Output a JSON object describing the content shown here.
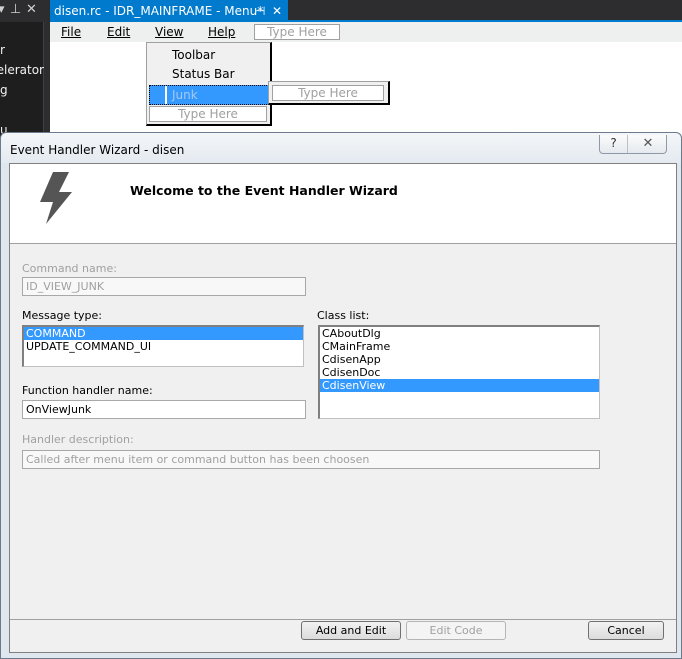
{
  "ide": {
    "side_panel_items": [
      "r",
      "elerator",
      "g",
      "",
      "u"
    ],
    "document_tab": {
      "title": "disen.rc - IDR_MAINFRAME - Menu*",
      "pin_icon": "pin-icon",
      "close_icon": "close-icon"
    },
    "menu_editor": {
      "menubar_items": [
        "File",
        "Edit",
        "View",
        "Help"
      ],
      "menubar_type_here": "Type Here",
      "view_dropdown_items": [
        "Toolbar",
        "Status Bar"
      ],
      "selected_item": "Junk",
      "dropdown_type_here": "Type Here",
      "submenu_type_here": "Type Here"
    }
  },
  "dialog": {
    "title": "Event Handler Wizard - disen",
    "help_button": "?",
    "close_button": "✕",
    "banner_title": "Welcome to the Event Handler Wizard",
    "command_name": {
      "label": "Command name:",
      "value": "ID_VIEW_JUNK"
    },
    "message_type": {
      "label": "Message type:",
      "items": [
        "COMMAND",
        "UPDATE_COMMAND_UI"
      ],
      "selected_index": 0
    },
    "class_list": {
      "label": "Class list:",
      "items": [
        "CAboutDlg",
        "CMainFrame",
        "CdisenApp",
        "CdisenDoc",
        "CdisenView"
      ],
      "selected_index": 4
    },
    "function_handler": {
      "label": "Function handler name:",
      "value": "OnViewJunk"
    },
    "handler_description": {
      "label": "Handler description:",
      "value": "Called after menu item or command button has been choosen"
    },
    "buttons": {
      "add_and_edit": "Add and Edit",
      "edit_code": "Edit Code",
      "cancel": "Cancel"
    }
  }
}
